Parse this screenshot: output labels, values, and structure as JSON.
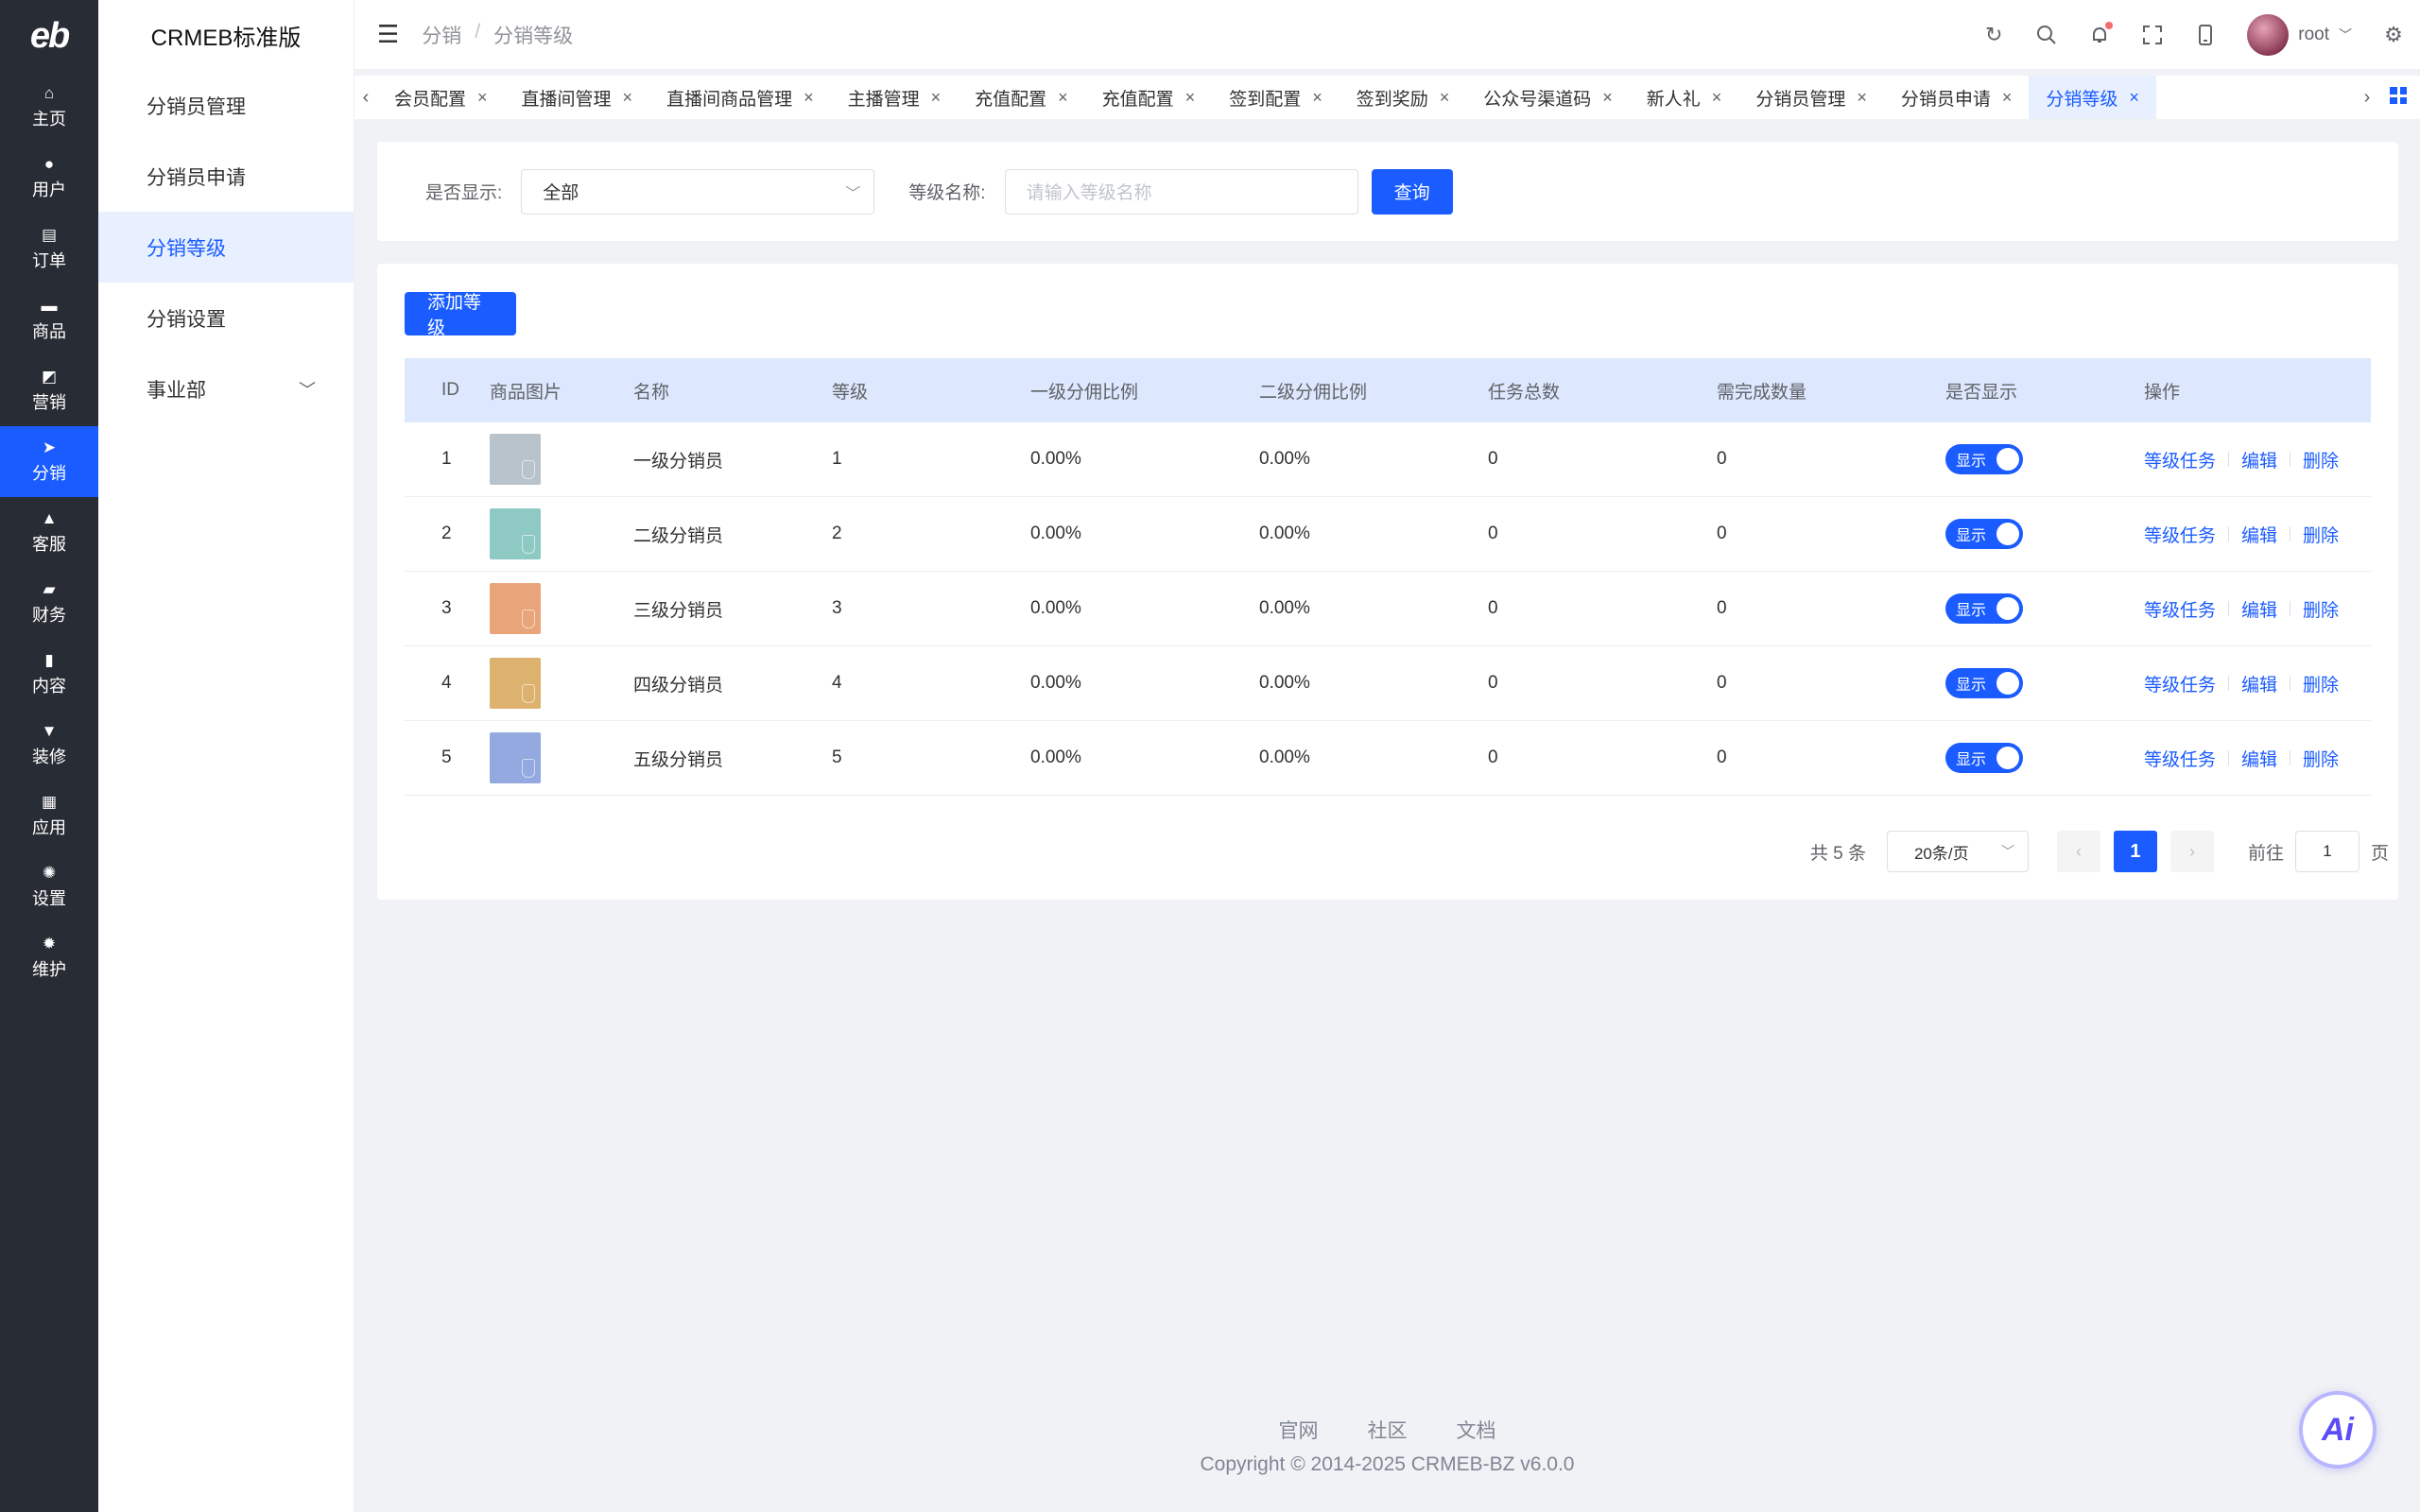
{
  "rail": {
    "logo": "eb",
    "items": [
      {
        "label": "主页",
        "icon": "home-icon",
        "glyph": "⌂"
      },
      {
        "label": "用户",
        "icon": "user-icon",
        "glyph": "●"
      },
      {
        "label": "订单",
        "icon": "order-icon",
        "glyph": "▤"
      },
      {
        "label": "商品",
        "icon": "product-icon",
        "glyph": "▬"
      },
      {
        "label": "营销",
        "icon": "marketing-icon",
        "glyph": "◩"
      },
      {
        "label": "分销",
        "icon": "distribution-icon",
        "glyph": "➤"
      },
      {
        "label": "客服",
        "icon": "service-bell-icon",
        "glyph": "▲"
      },
      {
        "label": "财务",
        "icon": "finance-icon",
        "glyph": "▰"
      },
      {
        "label": "内容",
        "icon": "content-icon",
        "glyph": "▮"
      },
      {
        "label": "装修",
        "icon": "decorate-icon",
        "glyph": "▼"
      },
      {
        "label": "应用",
        "icon": "apps-icon",
        "glyph": "▦"
      },
      {
        "label": "设置",
        "icon": "settings-icon",
        "glyph": "✺"
      },
      {
        "label": "维护",
        "icon": "maintain-icon",
        "glyph": "✹"
      }
    ]
  },
  "subnav": {
    "title": "CRMEB标准版",
    "items": [
      "分销员管理",
      "分销员申请",
      "分销等级",
      "分销设置",
      "事业部"
    ]
  },
  "header": {
    "crumb_parent": "分销",
    "crumb_sep": "/",
    "crumb_current": "分销等级",
    "username": "root"
  },
  "tabs": [
    "会员配置",
    "直播间管理",
    "直播间商品管理",
    "主播管理",
    "充值配置",
    "充值配置",
    "签到配置",
    "签到奖励",
    "公众号渠道码",
    "新人礼",
    "分销员管理",
    "分销员申请",
    "分销等级"
  ],
  "filter": {
    "show_label": "是否显示:",
    "show_value": "全部",
    "name_label": "等级名称:",
    "name_placeholder": "请输入等级名称",
    "query_button": "查询"
  },
  "table": {
    "add_button": "添加等级",
    "columns": [
      "ID",
      "商品图片",
      "名称",
      "等级",
      "一级分佣比例",
      "二级分佣比例",
      "任务总数",
      "需完成数量",
      "是否显示",
      "操作"
    ],
    "rows": [
      {
        "id": "1",
        "name": "一级分销员",
        "level": "1",
        "r1": "0.00%",
        "r2": "0.00%",
        "tasks": "0",
        "need": "0",
        "show": "显示",
        "color": "#b9c3cc"
      },
      {
        "id": "2",
        "name": "二级分销员",
        "level": "2",
        "r1": "0.00%",
        "r2": "0.00%",
        "tasks": "0",
        "need": "0",
        "show": "显示",
        "color": "#8ec9c3"
      },
      {
        "id": "3",
        "name": "三级分销员",
        "level": "3",
        "r1": "0.00%",
        "r2": "0.00%",
        "tasks": "0",
        "need": "0",
        "show": "显示",
        "color": "#e9a47a"
      },
      {
        "id": "4",
        "name": "四级分销员",
        "level": "4",
        "r1": "0.00%",
        "r2": "0.00%",
        "tasks": "0",
        "need": "0",
        "show": "显示",
        "color": "#ddb26e"
      },
      {
        "id": "5",
        "name": "五级分销员",
        "level": "5",
        "r1": "0.00%",
        "r2": "0.00%",
        "tasks": "0",
        "need": "0",
        "show": "显示",
        "color": "#93a9df"
      }
    ],
    "ops": [
      "等级任务",
      "编辑",
      "删除"
    ]
  },
  "pagination": {
    "total": "共 5 条",
    "page_size": "20条/页",
    "current": "1",
    "goto_label": "前往",
    "goto_value": "1",
    "page_suffix": "页"
  },
  "footer": {
    "links": [
      "官网",
      "社区",
      "文档"
    ],
    "copyright": "Copyright © 2014-2025 CRMEB-BZ v6.0.0"
  },
  "ai_label": "Ai",
  "colors": {
    "accent": "#1a5cff",
    "rail_bg": "#282c34",
    "header_row": "#dde8ff"
  }
}
